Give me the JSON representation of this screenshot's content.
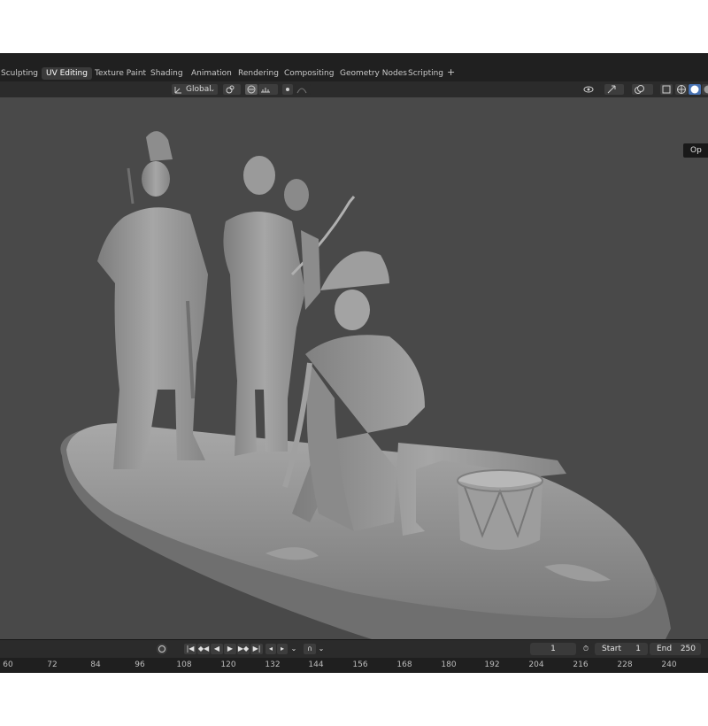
{
  "workspace_tabs": [
    {
      "label": "Sculpting"
    },
    {
      "label": "UV Editing",
      "active": true
    },
    {
      "label": "Texture Paint"
    },
    {
      "label": "Shading"
    },
    {
      "label": "Animation"
    },
    {
      "label": "Rendering"
    },
    {
      "label": "Compositing"
    },
    {
      "label": "Geometry Nodes"
    },
    {
      "label": "Scripting"
    }
  ],
  "add_tab": "+",
  "viewport_header": {
    "transform_orientation": "Global",
    "icons": [
      "orientation-icon",
      "pivot-icon",
      "snap-icon",
      "snap-increment-icon",
      "proportional-edit-icon",
      "falloff-icon",
      "visibility-icon",
      "gizmo-icon",
      "overlay-icon",
      "xray-icon",
      "wireframe-shading-icon",
      "solid-shading-icon",
      "material-shading-icon"
    ]
  },
  "tooltip": "Op",
  "timeline": {
    "current_frame": "1",
    "start_label": "Start",
    "start_value": "1",
    "end_label": "End",
    "end_value": "250",
    "ruler_ticks": [
      "60",
      "72",
      "84",
      "96",
      "108",
      "120",
      "132",
      "144",
      "156",
      "168",
      "180",
      "192",
      "204",
      "216",
      "228",
      "240"
    ]
  },
  "colors": {
    "viewport_bg": "#494949",
    "header_bg": "#202020",
    "model_gray": "#8e8e8e"
  }
}
